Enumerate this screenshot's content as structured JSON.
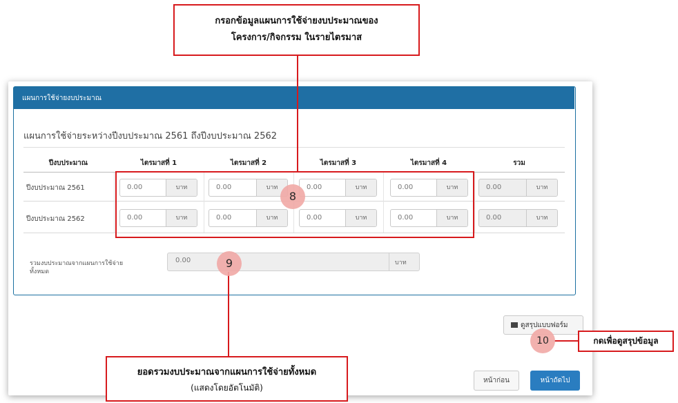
{
  "panel": {
    "title": "แผนการใช้จ่ายงบประมาณ"
  },
  "subtitle": "แผนการใช้จ่ายระหว่างปีงบประมาณ 2561 ถึงปีงบประมาณ 2562",
  "table": {
    "headers": [
      "ปีงบประมาณ",
      "ไตรมาสที่ 1",
      "ไตรมาสที่ 2",
      "ไตรมาสที่ 3",
      "ไตรมาสที่ 4",
      "รวม"
    ],
    "rows": [
      {
        "label": "ปีงบประมาณ 2561",
        "cells": [
          "0.00",
          "0.00",
          "0.00",
          "0.00",
          "0.00"
        ]
      },
      {
        "label": "ปีงบประมาณ 2562",
        "cells": [
          "0.00",
          "0.00",
          "0.00",
          "0.00",
          "0.00"
        ]
      }
    ],
    "unit": "บาท"
  },
  "total": {
    "label_line1": "รวมงบประมาณจากแผนการใช้จ่าย",
    "label_line2": "ทั้งหมด",
    "value": "0.00",
    "unit": "บาท"
  },
  "buttons": {
    "summary": "ดูสรุปแบบฟอร์ม",
    "prev": "หน้าก่อน",
    "next": "หน้าถัดไป"
  },
  "callouts": {
    "top_line1": "กรอกข้อมูลแผนการใช้จ่ายงบประมาณของ",
    "top_line2": "โครงการ/กิจกรรม ในรายไตรมาส",
    "bottom_line1": "ยอดรวมงบประมาณจากแผนการใช้จ่ายทั้งหมด",
    "bottom_line2": "(แสดงโดยอัตโนมัติ)",
    "right": "กดเพื่อดูสรุปข้อมูล"
  },
  "markers": {
    "m8": "8",
    "m9": "9",
    "m10": "10"
  },
  "colors": {
    "header_blue": "#1f6fa4",
    "button_blue": "#2a7dc0",
    "callout_red": "#d7191c",
    "marker_pink": "#f1a9a6"
  }
}
